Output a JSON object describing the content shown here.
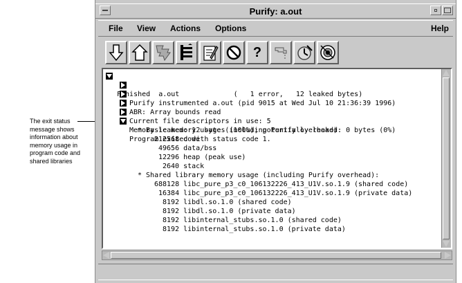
{
  "annotation": {
    "text": "The exit status message shows information about memory usage in program code and shared libraries"
  },
  "window": {
    "title": "Purify: a.out",
    "menu": [
      "File",
      "View",
      "Actions",
      "Options",
      "Help"
    ]
  },
  "toolbar": {
    "icons": [
      "arrow-down-icon",
      "house-icon",
      "expand-tree-icon",
      "collapse-tree-icon",
      "edit-icon",
      "stop-icon",
      "help-icon",
      "tap-icon",
      "clock-icon",
      "bulls-eye-icon"
    ],
    "help_label": "?"
  },
  "tree": {
    "rows": [
      {
        "text": "Finished  a.out             (   1 error,   12 leaked bytes)"
      },
      {
        "text": "Purify instrumented a.out (pid 9015 at Wed Jul 10 21:36:39 1996)"
      },
      {
        "text": "ABR: Array bounds read"
      },
      {
        "text": "Current file descriptors in use: 5"
      },
      {
        "text": "Memory leaked: 12 bytes (100%); potentially leaked: 0 bytes (0%)"
      },
      {
        "text": "Program exited with status code 1."
      },
      {
        "text": "* Basic memory usage (including Purify overhead):"
      },
      {
        "text": "212568 code"
      },
      {
        "text": "49656 data/bss"
      },
      {
        "text": "12296 heap (peak use)"
      },
      {
        "text": "2640 stack"
      },
      {
        "text": "* Shared library memory usage (including Purify overhead):"
      },
      {
        "text": "688128 libc_pure_p3_c0_106132226_413_U1V.so.1.9 (shared code)"
      },
      {
        "text": "16384 libc_pure_p3_c0_106132226_413_U1V.so.1.9 (private data)"
      },
      {
        "text": "8192 libdl.so.1.0 (shared code)"
      },
      {
        "text": "8192 libdl.so.1.0 (private data)"
      },
      {
        "text": "8192 libinternal_stubs.so.1.0 (shared code)"
      },
      {
        "text": "8192 libinternal_stubs.so.1.0 (private data)"
      }
    ]
  }
}
